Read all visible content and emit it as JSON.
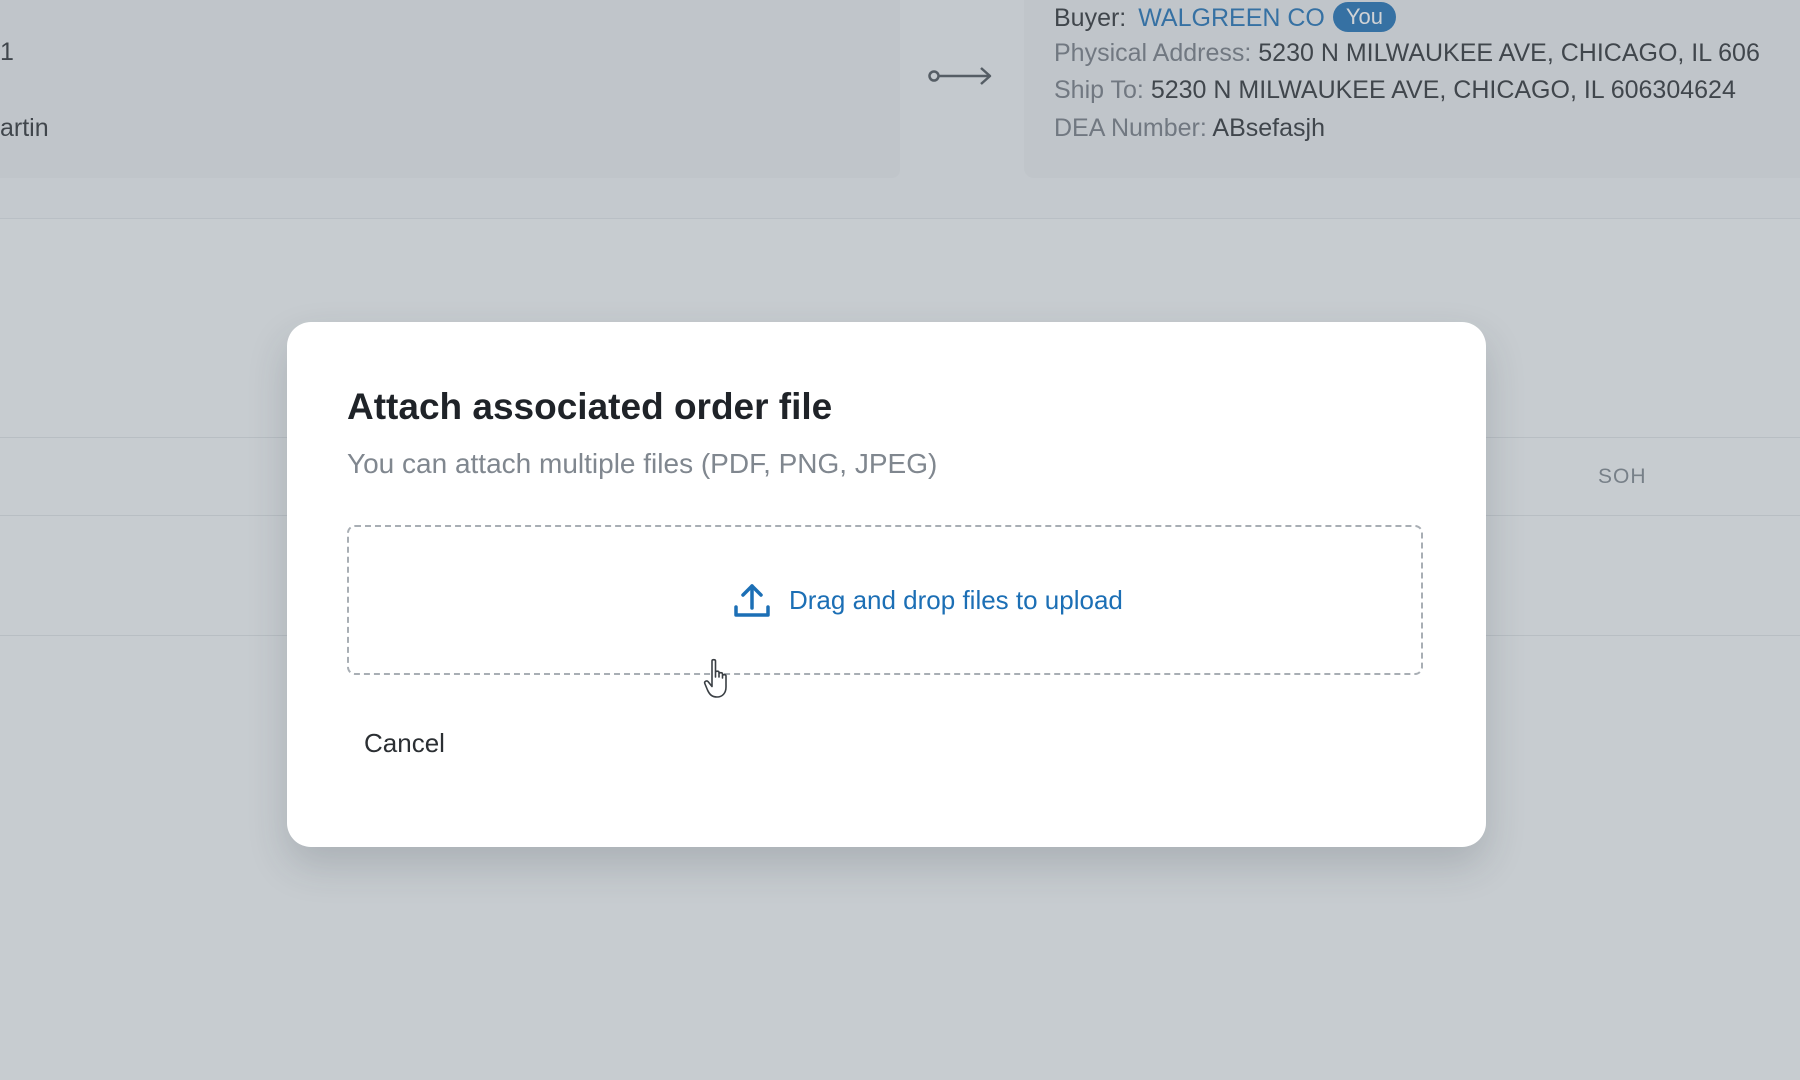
{
  "seller": {
    "line1": "1",
    "line2": "artin"
  },
  "buyer": {
    "label": "Buyer:",
    "name": "WALGREEN CO",
    "badge": "You",
    "physical_address_label": "Physical Address:",
    "physical_address": "5230 N MILWAUKEE AVE, CHICAGO, IL 606",
    "ship_to_label": "Ship To:",
    "ship_to": "5230 N MILWAUKEE AVE, CHICAGO, IL 606304624",
    "dea_label": "DEA Number:",
    "dea_number": "ABsefasjh"
  },
  "table": {
    "soh_header": "SOH"
  },
  "modal": {
    "title": "Attach associated order file",
    "subtitle": "You can attach multiple files (PDF, PNG, JPEG)",
    "dropzone_text": "Drag and drop files to upload",
    "cancel_label": "Cancel"
  },
  "icons": {
    "arrow": "long-arrow-right-icon",
    "upload": "upload-icon",
    "cursor": "hand-pointer-cursor-icon"
  },
  "colors": {
    "accent": "#1c6fb5",
    "text_primary": "#1f2328",
    "text_muted": "#80878f"
  }
}
